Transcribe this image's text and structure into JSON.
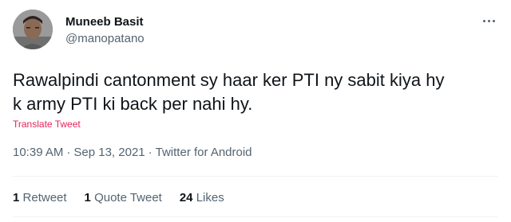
{
  "tweet": {
    "author": {
      "display_name": "Muneeb Basit",
      "handle": "@manopatano"
    },
    "text": "Rawalpindi cantonment sy haar ker PTI ny sabit kiya hy\nk army PTI ki back per nahi hy.",
    "translate_label": "Translate Tweet",
    "time": "10:39 AM",
    "date": "Sep 13, 2021",
    "separator": "·",
    "source": "Twitter for Android",
    "stats": {
      "retweets": {
        "count": "1",
        "label": "Retweet"
      },
      "quote_tweets": {
        "count": "1",
        "label": "Quote Tweet"
      },
      "likes": {
        "count": "24",
        "label": "Likes"
      }
    }
  },
  "icons": {
    "avatar": "user-photo",
    "more": "more-options-icon"
  },
  "colors": {
    "text_primary": "#0f1419",
    "text_secondary": "#536471",
    "translate_link": "#e0245e"
  }
}
